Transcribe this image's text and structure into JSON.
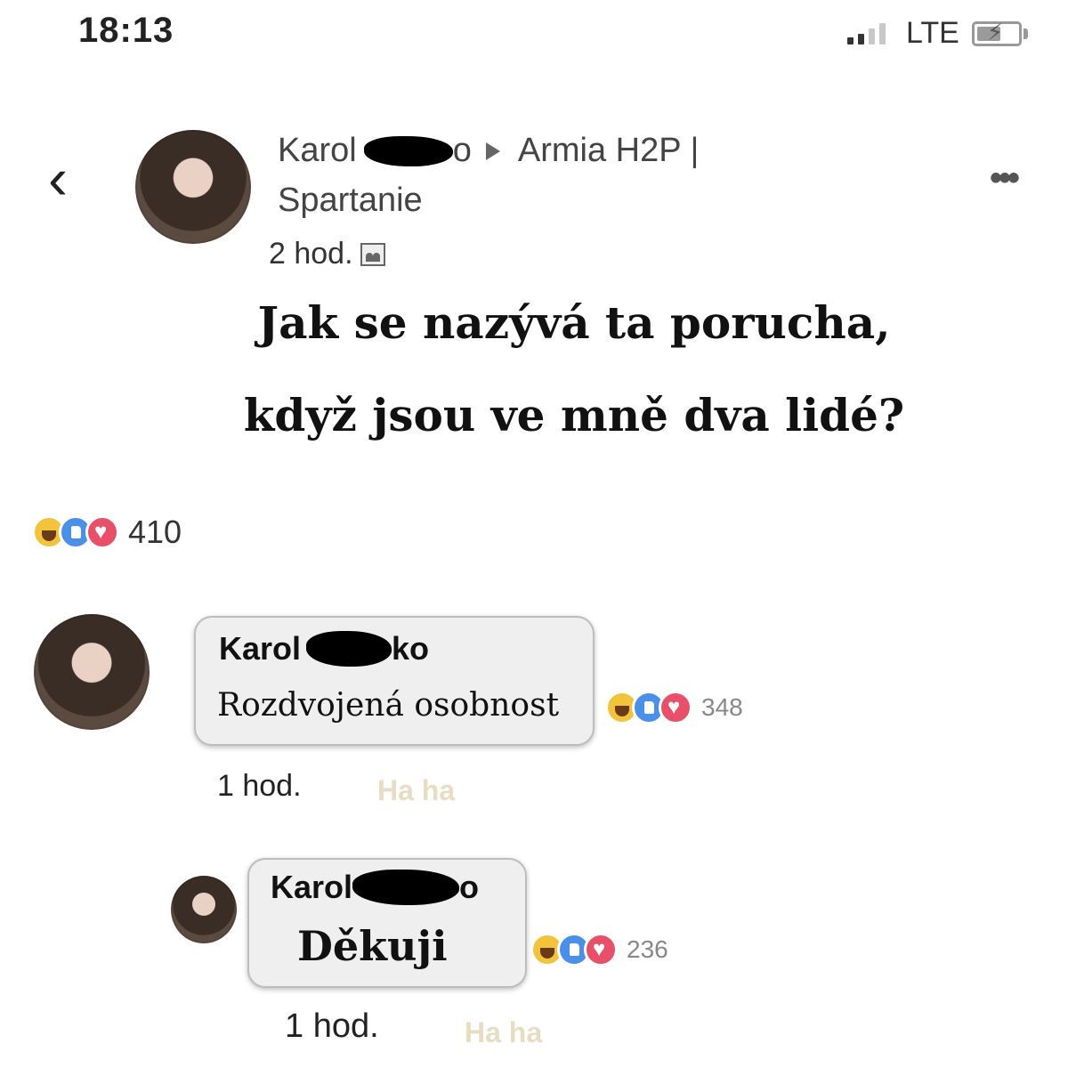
{
  "status_bar": {
    "time": "18:13",
    "network": "LTE",
    "battery_level_percent": 50
  },
  "header": {
    "back_icon": "chevron-left-icon",
    "poster_first_name": "Karol",
    "poster_name_tail": "o",
    "group_name_line1": "Armia H2P |",
    "group_name_line2": "Spartanie",
    "timestamp": "2 hod.",
    "more_icon": "more-horizontal-icon"
  },
  "post": {
    "text_line1": "Jak se nazývá ta porucha,",
    "text_line2": "když jsou ve mně dva lidé?",
    "reaction_count": "410"
  },
  "comments": [
    {
      "author_first": "Karol",
      "author_tail": "ko",
      "text": "Rozdvojená osobnost",
      "time": "1 hod.",
      "reaction_link": "Ha ha",
      "reaction_count": "348"
    },
    {
      "author_first": "Karol",
      "author_tail": "o",
      "text": "Děkuji",
      "time": "1 hod.",
      "reaction_link": "Ha ha",
      "reaction_count": "236"
    }
  ],
  "colors": {
    "haha": "#f2c43b",
    "like": "#4a8fe8",
    "love": "#e8506a",
    "bubble": "#efefef"
  }
}
